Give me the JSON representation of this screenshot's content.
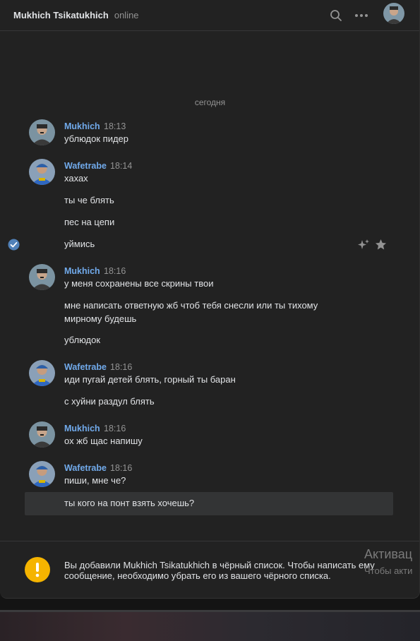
{
  "header": {
    "name": "Mukhich Tsikatukhich",
    "status": "online",
    "icons": [
      "search-icon",
      "more-icon"
    ]
  },
  "date_separator": "сегодня",
  "messages": [
    {
      "author": "Mukhich",
      "time": "18:13",
      "avatar": "mukhich",
      "lines": [
        "ублюдок пидер"
      ]
    },
    {
      "author": "Wafetrabe",
      "time": "18:14",
      "avatar": "wafetrabe",
      "lines": [
        "хахах",
        "ты че блять",
        "пес на цепи",
        "уймись"
      ]
    },
    {
      "author": "Mukhich",
      "time": "18:16",
      "avatar": "mukhich",
      "lines": [
        "у меня сохранены все скрины твои",
        "мне написать ответную жб чтоб тебя снесли или ты тихому мирному будешь",
        "ублюдок"
      ]
    },
    {
      "author": "Wafetrabe",
      "time": "18:16",
      "avatar": "wafetrabe",
      "lines": [
        "иди пугай детей блять, горный ты баран",
        "с хуйни раздул блять"
      ]
    },
    {
      "author": "Mukhich",
      "time": "18:16",
      "avatar": "mukhich",
      "lines": [
        "ох жб щас напишу"
      ]
    },
    {
      "author": "Wafetrabe",
      "time": "18:16",
      "avatar": "wafetrabe",
      "lines": [
        "пиши, мне че?",
        "ты кого на понт взять хочешь?"
      ]
    }
  ],
  "blacklist_notice": "Вы добавили Mukhich Tsikatukhich в чёрный список. Чтобы написать ему сообщение, необходимо убрать его из вашего чёрного списка.",
  "watermark": {
    "title": "Активац",
    "subtitle": "Чтобы акти"
  },
  "colors": {
    "accent": "#71aaeb",
    "background": "#222222",
    "warning": "#f5b400"
  }
}
